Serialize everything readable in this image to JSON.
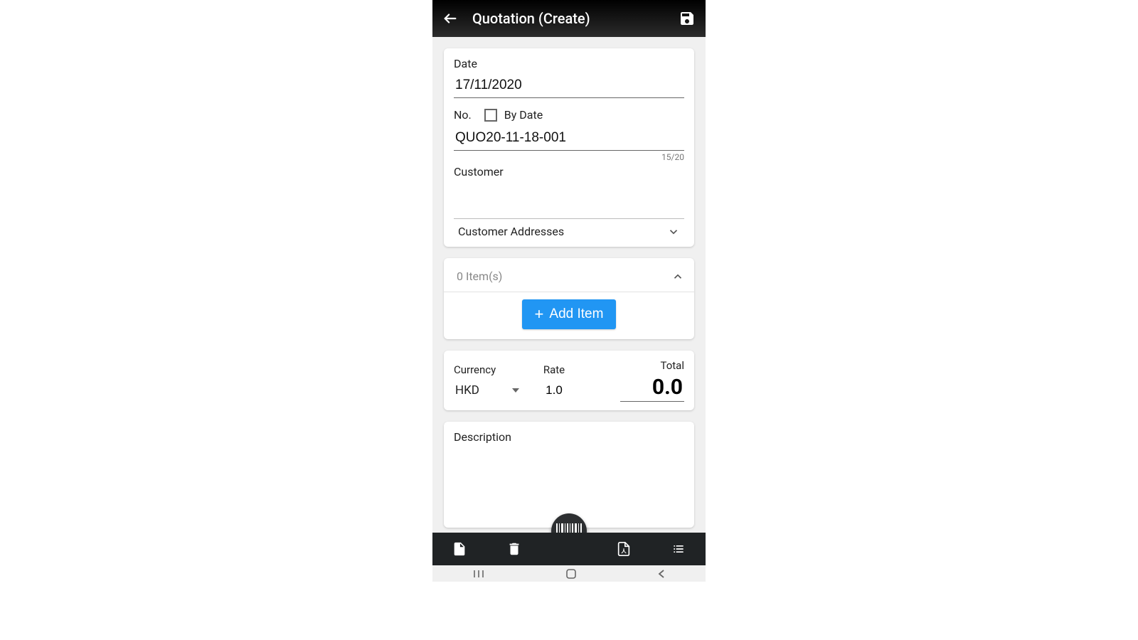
{
  "appbar": {
    "title": "Quotation (Create)"
  },
  "form": {
    "date_label": "Date",
    "date_value": "17/11/2020",
    "no_label": "No.",
    "by_date_label": "By Date",
    "no_value": "QUO20-11-18-001",
    "no_counter": "15/20",
    "customer_label": "Customer",
    "customer_value": "",
    "addresses_label": "Customer Addresses"
  },
  "items": {
    "count_label": "0 Item(s)",
    "add_label": "Add Item"
  },
  "currency": {
    "currency_label": "Currency",
    "currency_value": "HKD",
    "rate_label": "Rate",
    "rate_value": "1.0",
    "total_label": "Total",
    "total_value": "0.0"
  },
  "description": {
    "label": "Description",
    "value": ""
  }
}
